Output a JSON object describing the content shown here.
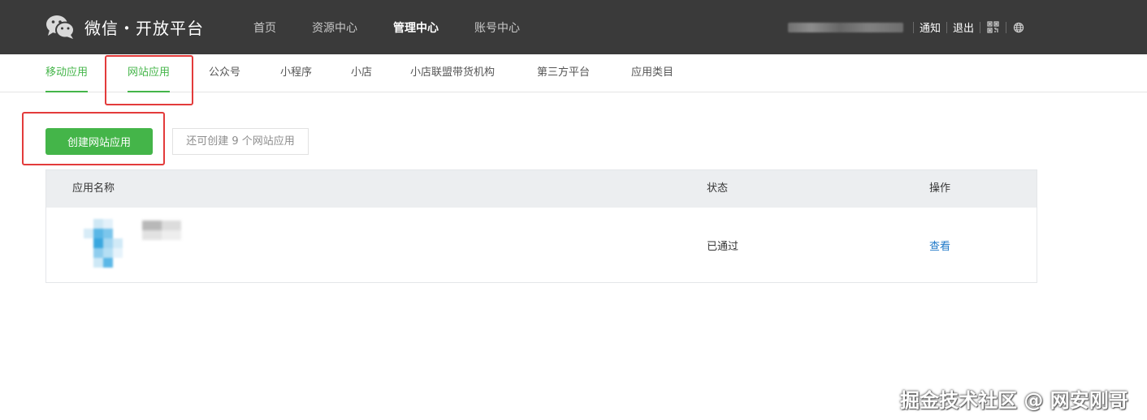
{
  "header": {
    "logo_text": "微信・开放平台",
    "nav": [
      {
        "label": "首页",
        "active": false
      },
      {
        "label": "资源中心",
        "active": false
      },
      {
        "label": "管理中心",
        "active": true
      },
      {
        "label": "账号中心",
        "active": false
      }
    ],
    "user": {
      "notify_label": "通知",
      "logout_label": "退出",
      "icons": [
        "qrcode-icon",
        "globe-icon"
      ]
    }
  },
  "subnav": {
    "items": [
      {
        "label": "移动应用"
      },
      {
        "label": "网站应用"
      },
      {
        "label": "公众号"
      },
      {
        "label": "小程序"
      },
      {
        "label": "小店"
      },
      {
        "label": "小店联盟带货机构"
      },
      {
        "label": "第三方平台"
      },
      {
        "label": "应用类目"
      }
    ]
  },
  "main": {
    "create_button_label": "创建网站应用",
    "create_tip": "还可创建 9 个网站应用",
    "table": {
      "columns": [
        "应用名称",
        "状态",
        "操作"
      ],
      "rows": [
        {
          "status": "已通过",
          "action": "查看"
        }
      ]
    }
  },
  "watermark": "掘金技术社区 @ 网安刚哥",
  "colors": {
    "topbar": "#3a3a3a",
    "brand_green": "#44b549",
    "link_blue": "#1e78c8",
    "annotation_red": "#e33b3b",
    "table_header": "#eceef0"
  }
}
